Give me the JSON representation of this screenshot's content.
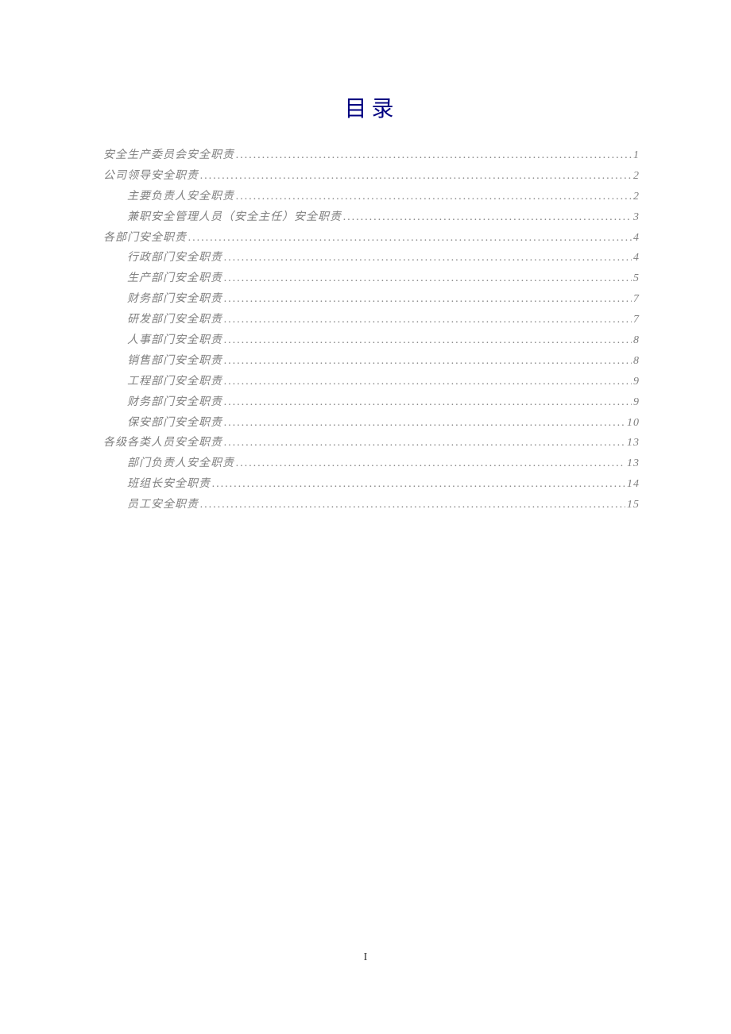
{
  "title": "目录",
  "page_number": "I",
  "toc": [
    {
      "label": "安全生产委员会安全职责",
      "page": "1",
      "level": 1
    },
    {
      "label": "公司领导安全职责",
      "page": "2",
      "level": 1
    },
    {
      "label": "主要负责人安全职责",
      "page": "2",
      "level": 2
    },
    {
      "label": "兼职安全管理人员（安全主任）安全职责",
      "page": "3",
      "level": 2
    },
    {
      "label": "各部门安全职责",
      "page": "4",
      "level": 1
    },
    {
      "label": "行政部门安全职责",
      "page": "4",
      "level": 2
    },
    {
      "label": "生产部门安全职责",
      "page": "5",
      "level": 2
    },
    {
      "label": "财务部门安全职责",
      "page": "7",
      "level": 2
    },
    {
      "label": "研发部门安全职责",
      "page": "7",
      "level": 2
    },
    {
      "label": "人事部门安全职责",
      "page": "8",
      "level": 2
    },
    {
      "label": "销售部门安全职责",
      "page": "8",
      "level": 2
    },
    {
      "label": "工程部门安全职责",
      "page": "9",
      "level": 2
    },
    {
      "label": "财务部门安全职责",
      "page": "9",
      "level": 2
    },
    {
      "label": "保安部门安全职责",
      "page": "10",
      "level": 2
    },
    {
      "label": "各级各类人员安全职责",
      "page": "13",
      "level": 1
    },
    {
      "label": "部门负责人安全职责",
      "page": "13",
      "level": 2
    },
    {
      "label": "班组长安全职责",
      "page": "14",
      "level": 2
    },
    {
      "label": "员工安全职责",
      "page": "15",
      "level": 2
    }
  ]
}
